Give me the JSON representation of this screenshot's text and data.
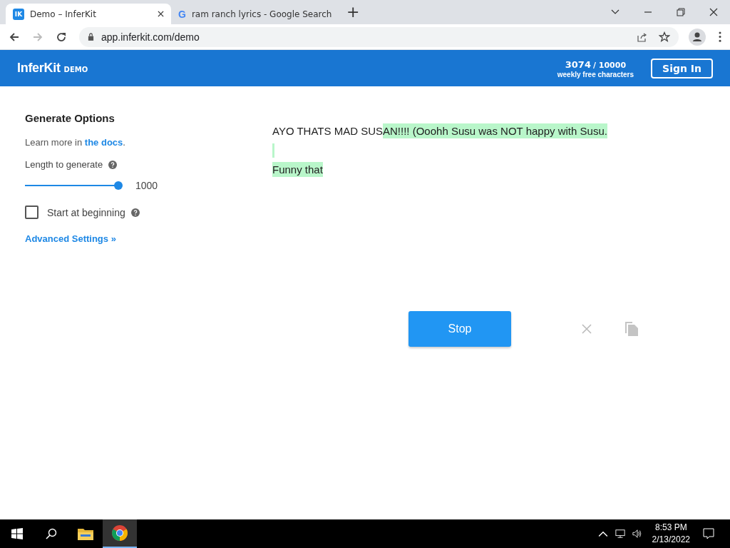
{
  "browser": {
    "tabs": [
      {
        "title": "Demo – InferKit",
        "kind": "ik",
        "icon_text": "IK",
        "selected": true
      },
      {
        "title": "ram ranch lyrics - Google Search",
        "kind": "g",
        "icon_text": "G",
        "selected": false
      }
    ],
    "new_tab": "+",
    "address": "app.inferkit.com/demo"
  },
  "header": {
    "brand": "InferKit",
    "badge": "DEMO",
    "count": "3074",
    "limit": "/ 10000",
    "count_caption": "weekly free characters",
    "sign_in": "Sign In"
  },
  "options": {
    "title": "Generate Options",
    "learn_prefix": "Learn more in ",
    "learn_link": "the docs",
    "learn_suffix": ".",
    "length_label": "Length to generate",
    "length_value": "1000",
    "length_slider": {
      "level": 1.0
    },
    "start_label": "Start at beginning",
    "start_checked": false,
    "advanced": "Advanced Settings »"
  },
  "editor": {
    "lines": [
      {
        "segments": [
          {
            "text": "AYO THATS MAD SUS",
            "generated": false
          },
          {
            "text": "AN!!!! (Ooohh Susu was NOT happy with Susu.",
            "generated": true
          }
        ]
      },
      {
        "kind": "blank",
        "generated": true
      },
      {
        "segments": [
          {
            "text": "Funny that",
            "generated": true
          }
        ]
      }
    ]
  },
  "actions": {
    "stop": "Stop"
  },
  "taskbar": {
    "apps": [
      {
        "kind": "folder",
        "selected": false
      },
      {
        "kind": "chrome",
        "selected": true
      }
    ],
    "time": "8:53 PM",
    "date": "2/13/2022"
  }
}
